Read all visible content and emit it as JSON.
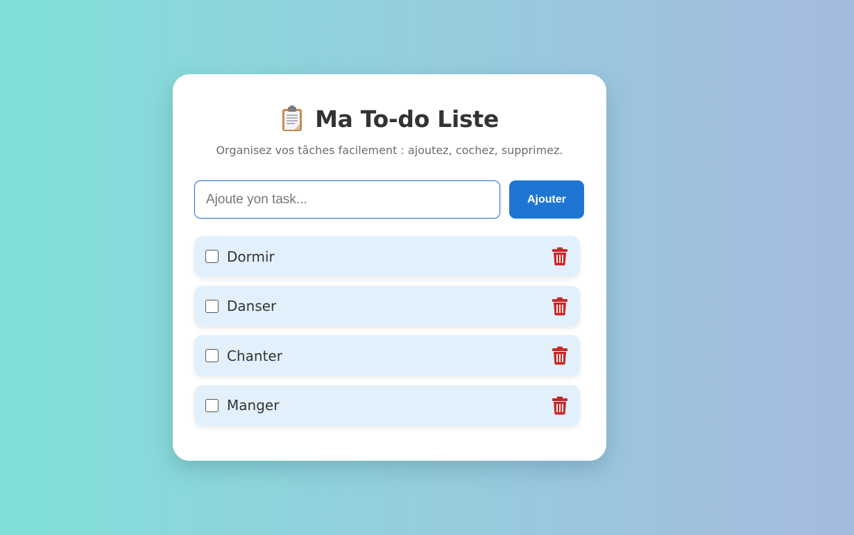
{
  "header": {
    "title": "Ma To-do Liste",
    "subtitle": "Organisez vos tâches facilement : ajoutez, cochez, supprimez.",
    "icon": "clipboard-icon"
  },
  "input": {
    "placeholder": "Ajoute yon task...",
    "value": ""
  },
  "add_button": {
    "label": "Ajouter"
  },
  "tasks": [
    {
      "label": "Dormir",
      "checked": false
    },
    {
      "label": "Danser",
      "checked": false
    },
    {
      "label": "Chanter",
      "checked": false
    },
    {
      "label": "Manger",
      "checked": false
    }
  ],
  "delete_icon": "trash-icon",
  "colors": {
    "accent": "#1f76d2",
    "delete": "#c62828",
    "task_background": "#e2f0fb"
  }
}
